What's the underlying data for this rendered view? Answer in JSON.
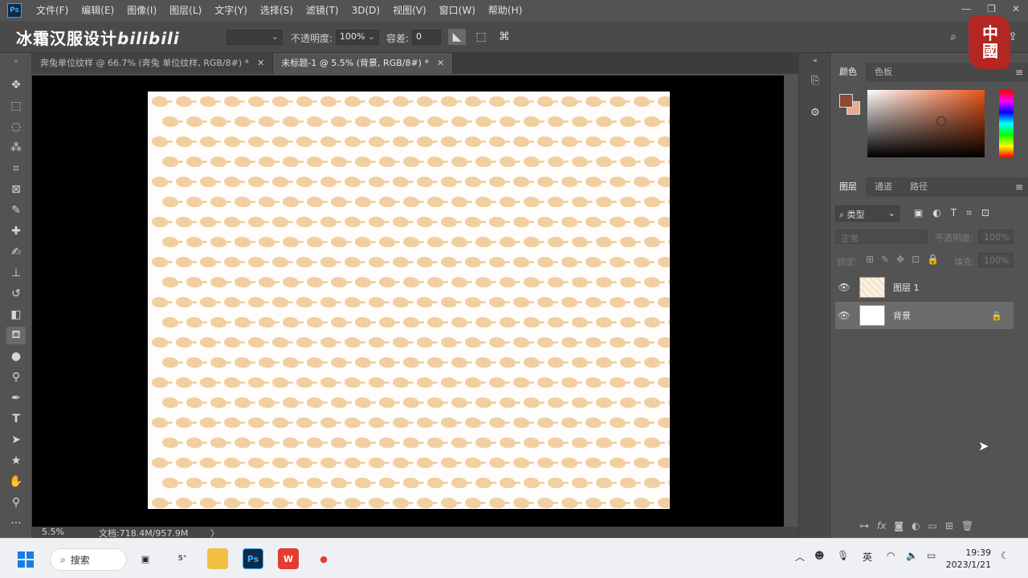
{
  "app": {
    "logo": "Ps"
  },
  "menu": [
    "文件(F)",
    "编辑(E)",
    "图像(I)",
    "图层(L)",
    "文字(Y)",
    "选择(S)",
    "滤镜(T)",
    "3D(D)",
    "视图(V)",
    "窗口(W)",
    "帮助(H)"
  ],
  "watermark": {
    "text": "冰霜汉服设计",
    "brand": "bilibili"
  },
  "stamp": {
    "text": "中國"
  },
  "options": {
    "opacity_label": "不透明度:",
    "opacity_value": "100%",
    "tolerance_label": "容差:",
    "tolerance_value": "0"
  },
  "tabs": [
    {
      "label": "奔兔单位纹样 @ 66.7% (奔兔 单位纹样, RGB/8#) *",
      "active": false
    },
    {
      "label": "未标题-1 @ 5.5% (背景, RGB/8#) *",
      "active": true
    }
  ],
  "status": {
    "zoom": "5.5%",
    "doc": "文档:718.4M/957.9M",
    "arrow": "〉"
  },
  "color_panel": {
    "tabs": [
      "颜色",
      "色板"
    ],
    "foreground": "#8a4a33",
    "background": "#e6aa8e"
  },
  "layers_panel": {
    "tabs": [
      "图层",
      "通道",
      "路径"
    ],
    "filter_label": "类型",
    "blend_mode": "正常",
    "opacity_label": "不透明度:",
    "opacity_value": "100%",
    "lock_label": "锁定:",
    "fill_label": "填充:",
    "fill_value": "100%",
    "layers": [
      {
        "name": "图层 1",
        "thumb": "pattern",
        "selected": false,
        "locked": false
      },
      {
        "name": "背景",
        "thumb": "white",
        "selected": true,
        "locked": true
      }
    ]
  },
  "taskbar": {
    "search_label": "搜索",
    "weather": "5°",
    "ime": "英",
    "time": "19:39",
    "date": "2023/1/21"
  },
  "colors": {
    "accent": "#34a9ff",
    "pattern": "#f1cfa1"
  }
}
